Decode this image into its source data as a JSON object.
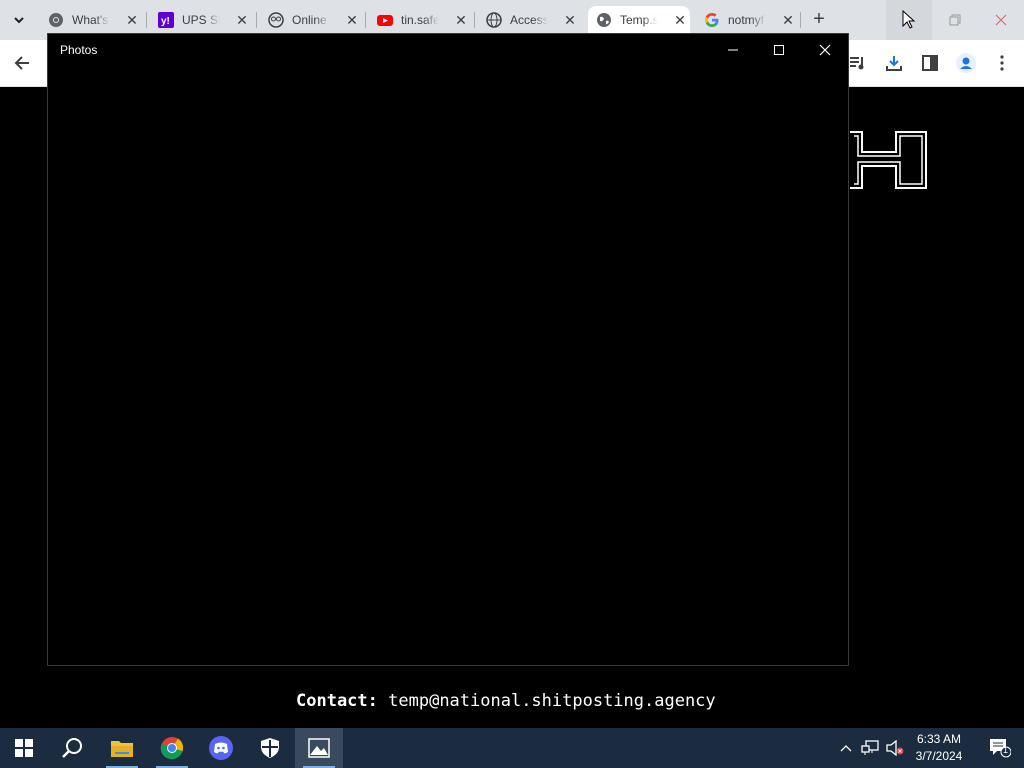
{
  "browser": {
    "tabs": [
      {
        "title": "What's",
        "icon": "chrome-icon"
      },
      {
        "title": "UPS St",
        "icon": "yahoo-icon"
      },
      {
        "title": "Online",
        "icon": "owl-icon"
      },
      {
        "title": "tin.safe",
        "icon": "youtube-icon"
      },
      {
        "title": "Access",
        "icon": "globe-icon"
      },
      {
        "title": "Temp.s",
        "icon": "globe-icon"
      },
      {
        "title": "notmyf",
        "icon": "google-icon"
      }
    ],
    "new_tab_label": "+"
  },
  "page": {
    "contact_label": "Contact:",
    "contact_email": "temp@national.shitposting.agency"
  },
  "photos_window": {
    "title": "Photos"
  },
  "taskbar": {
    "time": "6:33 AM",
    "date": "3/7/2024",
    "notification_count": "1"
  },
  "colors": {
    "taskbar_bg": "#1c2c40",
    "tabstrip_bg": "#dee1e6",
    "accent": "#1a73e8"
  }
}
